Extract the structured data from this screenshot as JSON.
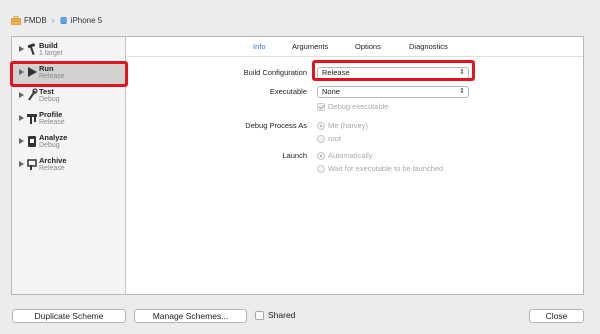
{
  "breadcrumb": {
    "project": "FMDB",
    "device": "iPhone 5"
  },
  "sidebar": {
    "items": [
      {
        "name": "Build",
        "detail": "1 target"
      },
      {
        "name": "Run",
        "detail": "Release"
      },
      {
        "name": "Test",
        "detail": "Debug"
      },
      {
        "name": "Profile",
        "detail": "Release"
      },
      {
        "name": "Analyze",
        "detail": "Debug"
      },
      {
        "name": "Archive",
        "detail": "Release"
      }
    ],
    "selected": "Run"
  },
  "tabs": [
    "Info",
    "Arguments",
    "Options",
    "Diagnostics"
  ],
  "active_tab": "Info",
  "settings": {
    "build_config_label": "Build Configuration",
    "build_config_value": "Release",
    "executable_label": "Executable",
    "executable_value": "None",
    "debug_executable": "Debug executable",
    "debug_process_label": "Debug Process As",
    "debug_me": "Me (harvey)",
    "debug_root": "root",
    "launch_label": "Launch",
    "launch_auto": "Automatically",
    "launch_wait": "Wait for executable to be launched"
  },
  "footer": {
    "duplicate": "Duplicate Scheme",
    "manage": "Manage Schemes...",
    "shared": "Shared",
    "close": "Close"
  },
  "colors": {
    "highlight": "#e4141e",
    "accent": "#2f7ae5"
  }
}
